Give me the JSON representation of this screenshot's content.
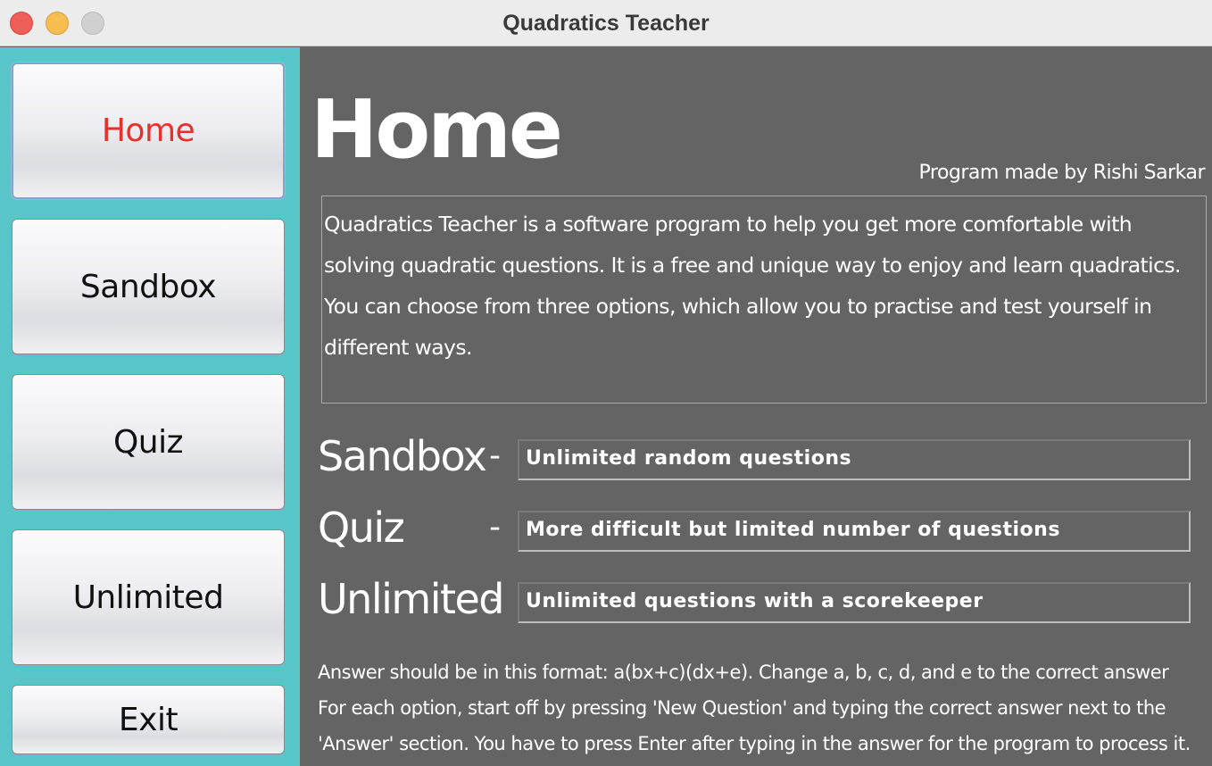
{
  "window": {
    "title": "Quadratics Teacher"
  },
  "sidebar": {
    "items": [
      {
        "label": "Home",
        "active": true
      },
      {
        "label": "Sandbox",
        "active": false
      },
      {
        "label": "Quiz",
        "active": false
      },
      {
        "label": "Unlimited",
        "active": false
      },
      {
        "label": "Exit",
        "active": false
      }
    ]
  },
  "main": {
    "heading": "Home",
    "credit": "Program made by Rishi Sarkar",
    "description": [
      "Quadratics Teacher is a software program to help you get more comfortable with",
      "solving quadratic questions. It is a free and unique way to enjoy and learn quadratics.",
      "You can choose from three options, which allow you to practise and test yourself in",
      "different ways."
    ],
    "options": [
      {
        "name": "Sandbox",
        "dash": "-",
        "detail": "Unlimited random questions"
      },
      {
        "name": "Quiz",
        "dash": "-",
        "detail": "More difficult but limited number of questions"
      },
      {
        "name": "Unlimited",
        "dash": "-",
        "detail": "Unlimited questions with a scorekeeper"
      }
    ],
    "instructions": [
      "Answer should be in this format: a(bx+c)(dx+e). Change a, b, c, d, and e to the correct answer",
      "For each option, start off by pressing  'New Question' and typing the correct answer next to the",
      "'Answer' section. You have to press Enter after typing in the answer for the program to process it."
    ]
  },
  "colors": {
    "sidebar_bg": "#58c6c9",
    "content_bg": "#646464",
    "active_label": "#e8302a"
  }
}
